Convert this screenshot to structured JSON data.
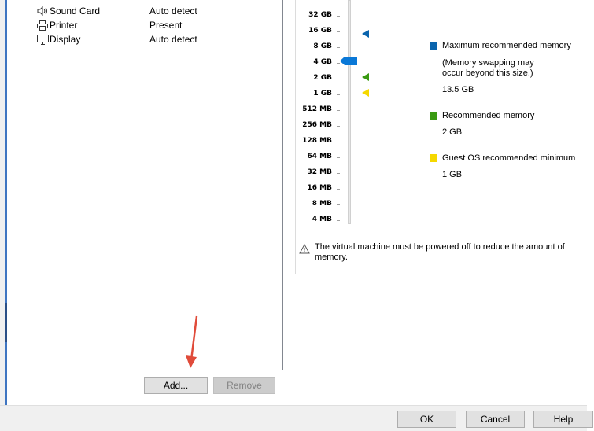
{
  "devices": [
    {
      "icon": "speaker-icon",
      "name": "Sound Card",
      "summary": "Auto detect"
    },
    {
      "icon": "printer-icon",
      "name": "Printer",
      "summary": "Present"
    },
    {
      "icon": "display-icon",
      "name": "Display",
      "summary": "Auto detect"
    }
  ],
  "device_buttons": {
    "add": "Add...",
    "remove": "Remove"
  },
  "memory": {
    "scale_labels": [
      "32 GB",
      "16 GB",
      "8 GB",
      "4 GB",
      "2 GB",
      "1 GB",
      "512 MB",
      "256 MB",
      "128 MB",
      "64 MB",
      "32 MB",
      "16 MB",
      "8 MB",
      "4 MB"
    ],
    "current_value": "4 GB",
    "legend": {
      "max_title": "Maximum recommended memory",
      "max_note": "(Memory swapping may occur beyond this size.)",
      "max_note_line1": "(Memory swapping may",
      "max_note_line2": "occur beyond this size.)",
      "max_value": "13.5 GB",
      "rec_title": "Recommended memory",
      "rec_value": "2 GB",
      "min_title": "Guest OS recommended minimum",
      "min_value": "1 GB"
    },
    "warning": "The virtual machine must be powered off to reduce the amount of memory."
  },
  "colors": {
    "max": "#0a64ad",
    "recommended": "#3a9a12",
    "minimum": "#f5d800",
    "arrow": "#e04b3a"
  },
  "footer": {
    "ok": "OK",
    "cancel": "Cancel",
    "help": "Help"
  }
}
